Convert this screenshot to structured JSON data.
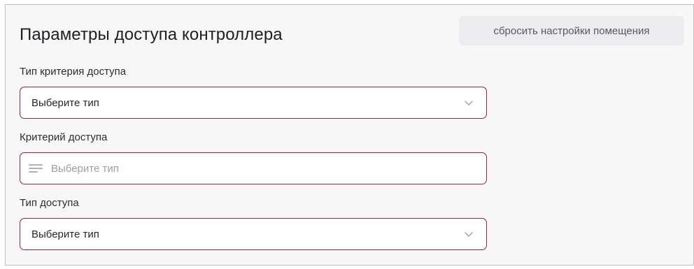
{
  "panel": {
    "title": "Параметры доступа контроллера",
    "reset_button": "сбросить настройки помещения"
  },
  "fields": {
    "access_criterion_type": {
      "label": "Тип критерия доступа",
      "value": "Выберите тип",
      "icon": "chevron-down-icon"
    },
    "access_criterion": {
      "label": "Критерий доступа",
      "placeholder": "Выберите тип",
      "value": "",
      "icon": "list-lines-icon"
    },
    "access_type": {
      "label": "Тип доступа",
      "value": "Выберите тип",
      "icon": "chevron-down-icon"
    }
  },
  "colors": {
    "field_border": "#8a2a35",
    "panel_bg": "#f7f7f8",
    "button_bg": "#ececee"
  }
}
